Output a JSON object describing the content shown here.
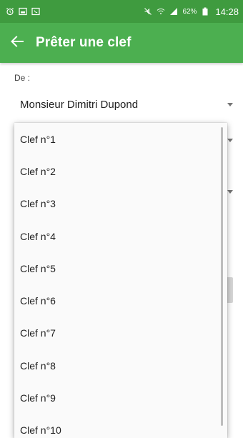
{
  "status_bar": {
    "battery_percent": "62%",
    "time": "14:28",
    "left_icons": [
      "alarm-icon",
      "gallery-icon",
      "phone-icon"
    ],
    "right_icons": [
      "mute-icon",
      "wifi-icon",
      "signal-icon",
      "battery-icon"
    ]
  },
  "app_bar": {
    "title": "Prêter une clef",
    "back_icon": "arrow-left-icon",
    "color": "#4caf50",
    "status_color": "#3f9b3f"
  },
  "form": {
    "from_label": "De :",
    "from_value": "Monsieur Dimitri Dupond"
  },
  "dropdown": {
    "items": [
      "Clef n°1",
      "Clef n°2",
      "Clef n°3",
      "Clef n°4",
      "Clef n°5",
      "Clef n°6",
      "Clef n°7",
      "Clef n°8",
      "Clef n°9",
      "Clef n°10"
    ]
  }
}
